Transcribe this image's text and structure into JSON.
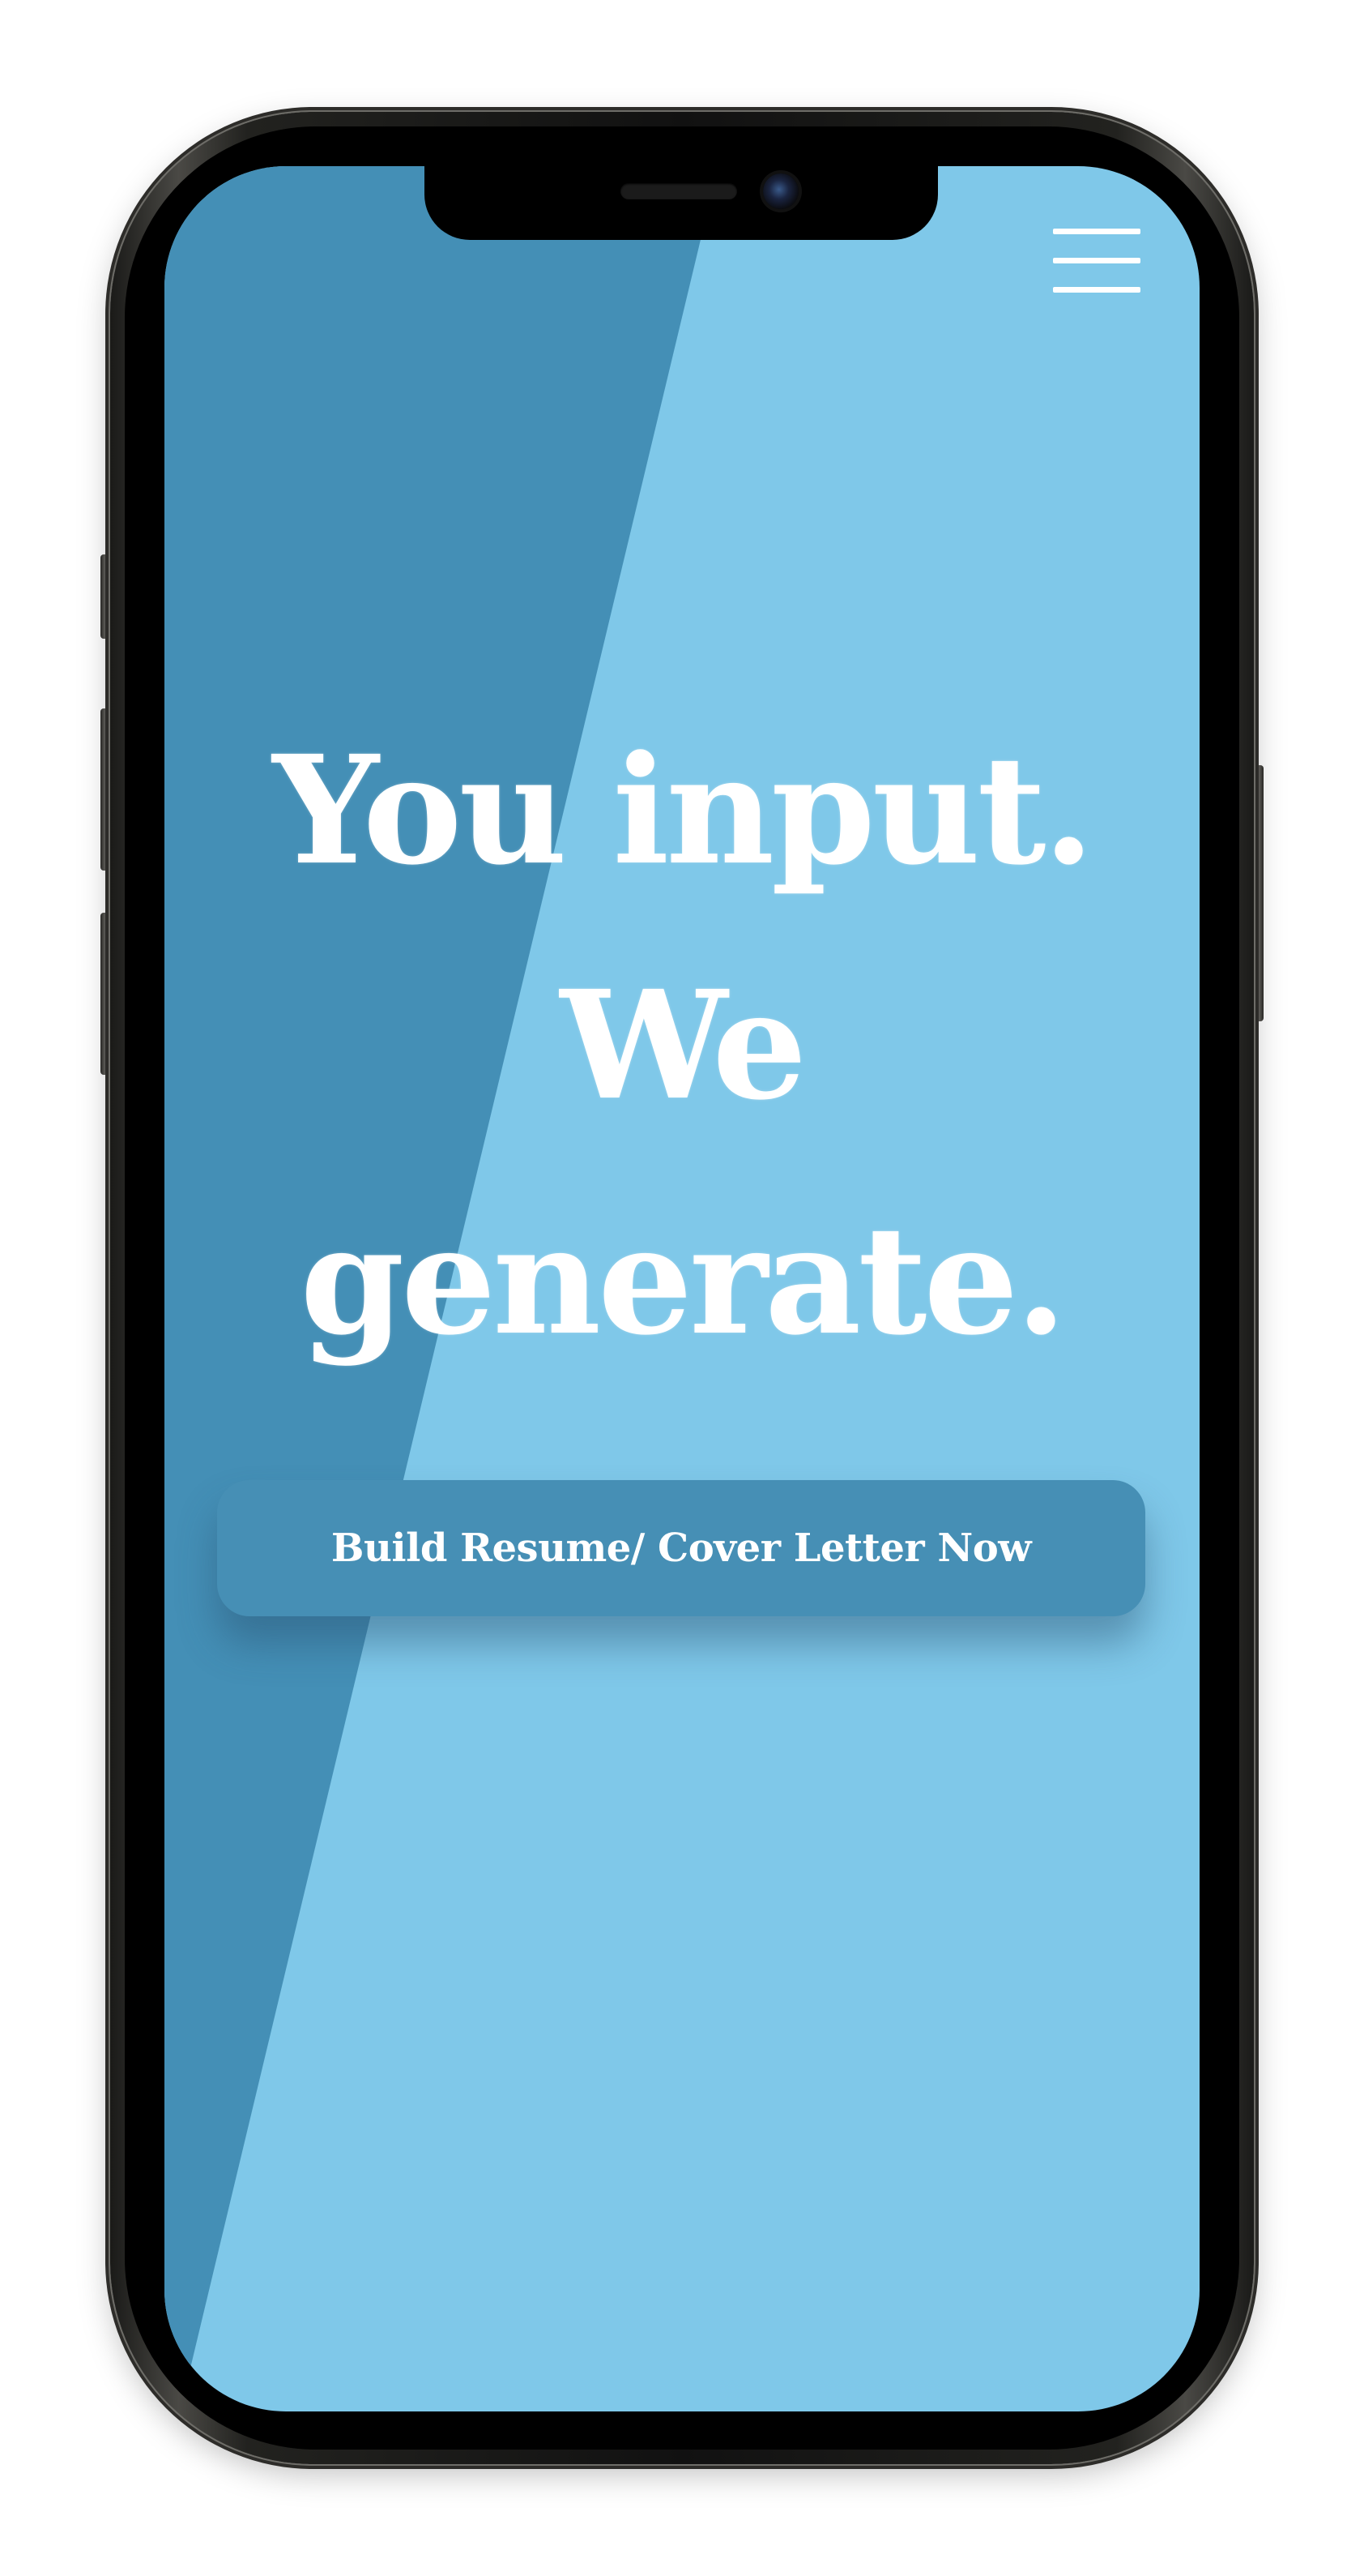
{
  "hero": {
    "line1": "You input.",
    "line2": "We",
    "line3": "generate."
  },
  "cta": {
    "label": "Build Resume/ Cover Letter Now"
  },
  "nav": {
    "menu_icon": "hamburger-menu-icon"
  },
  "colors": {
    "light_blue": "#7fc8e9",
    "dark_blue": "#448fb6",
    "button_blue": "#468fb5",
    "text": "#ffffff"
  }
}
